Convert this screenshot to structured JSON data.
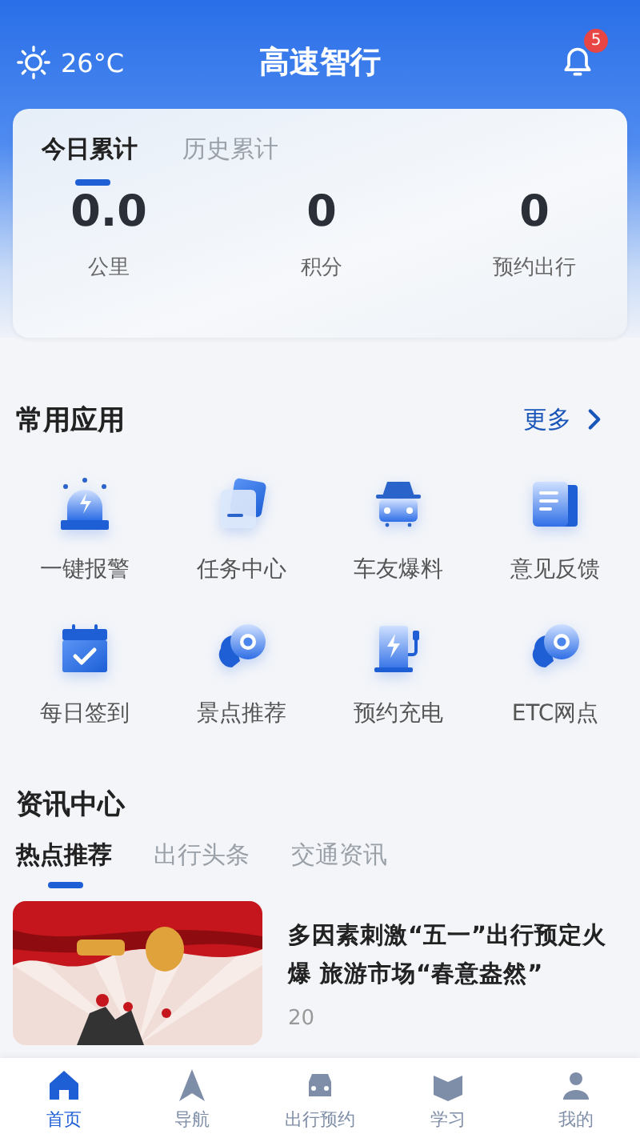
{
  "header": {
    "temperature": "26°C",
    "title": "高速智行",
    "notification_count": "5"
  },
  "stats_tabs": [
    {
      "label": "今日累计",
      "selected": true
    },
    {
      "label": "历史累计",
      "selected": false
    }
  ],
  "stats": [
    {
      "value": "0.0",
      "label": "公里"
    },
    {
      "value": "0",
      "label": "积分"
    },
    {
      "value": "0",
      "label": "预约出行"
    }
  ],
  "apps_section": {
    "title": "常用应用",
    "more": "更多"
  },
  "apps": [
    {
      "label": "一键报警"
    },
    {
      "label": "任务中心"
    },
    {
      "label": "车友爆料"
    },
    {
      "label": "意见反馈"
    },
    {
      "label": "每日签到"
    },
    {
      "label": "景点推荐"
    },
    {
      "label": "预约充电"
    },
    {
      "label": "ETC网点"
    }
  ],
  "news_section": {
    "title": "资讯中心"
  },
  "news_tabs": [
    {
      "label": "热点推荐",
      "selected": true
    },
    {
      "label": "出行头条",
      "selected": false
    },
    {
      "label": "交通资讯",
      "selected": false
    }
  ],
  "news": [
    {
      "kind": "picture",
      "title": "多因素刺激“五一”出行预定火爆 旅游市场“春意盎然”",
      "date": "20"
    }
  ],
  "bottom_nav": [
    {
      "label": "首页",
      "selected": true
    },
    {
      "label": "导航",
      "selected": false
    },
    {
      "label": "出行预约",
      "selected": false
    },
    {
      "label": "学习",
      "selected": false
    },
    {
      "label": "我的",
      "selected": false
    }
  ]
}
